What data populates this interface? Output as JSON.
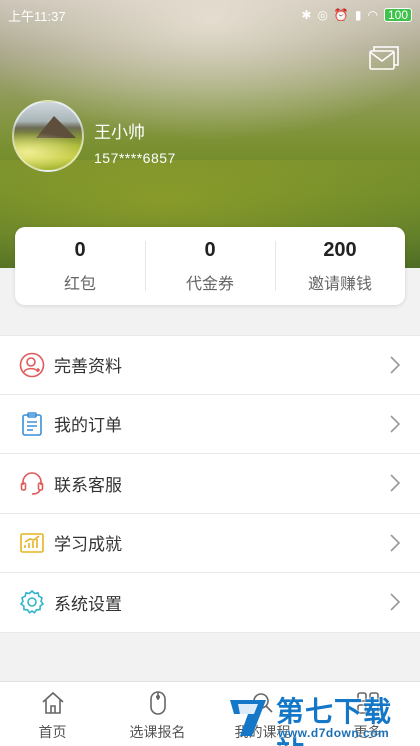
{
  "status_bar": {
    "time": "上午11:37",
    "battery": "100"
  },
  "profile": {
    "name": "王小帅",
    "phone": "157****6857"
  },
  "stats": [
    {
      "value": "0",
      "label": "红包"
    },
    {
      "value": "0",
      "label": "代金券"
    },
    {
      "value": "200",
      "label": "邀请赚钱"
    }
  ],
  "menu": [
    {
      "label": "完善资料",
      "icon": "profile-icon",
      "color": "#e05a5a"
    },
    {
      "label": "我的订单",
      "icon": "clipboard-icon",
      "color": "#3a8fd8"
    },
    {
      "label": "联系客服",
      "icon": "headset-icon",
      "color": "#e05a5a"
    },
    {
      "label": "学习成就",
      "icon": "chart-icon",
      "color": "#e6b325"
    },
    {
      "label": "系统设置",
      "icon": "gear-icon",
      "color": "#2fb5c9"
    }
  ],
  "tabs": [
    {
      "label": "首页",
      "icon": "home-icon"
    },
    {
      "label": "选课报名",
      "icon": "mouse-icon"
    },
    {
      "label": "我的课程",
      "icon": "search-icon"
    },
    {
      "label": "更多",
      "icon": "grid-icon"
    }
  ],
  "watermark": {
    "title": "第七下载站",
    "url": "www.d7down.com"
  },
  "colors": {
    "accent_red": "#e05a5a",
    "accent_blue": "#3a8fd8",
    "accent_yellow": "#e6b325",
    "accent_teal": "#2fb5c9",
    "watermark_blue": "#1477c8"
  }
}
